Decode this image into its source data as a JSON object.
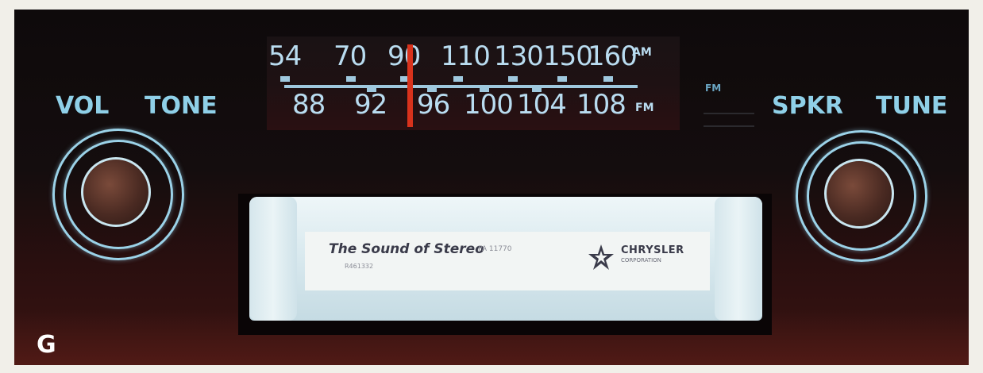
{
  "am_scale": [
    "54",
    "70",
    "90",
    "110",
    "130",
    "150",
    "160"
  ],
  "fm_scale": [
    "88",
    "92",
    "96",
    "100",
    "104",
    "108"
  ],
  "band_am": "AM",
  "band_fm": "FM",
  "fm_indicator": "FM",
  "controls": {
    "vol": "VOL",
    "tone": "TONE",
    "spkr": "SPKR",
    "tune": "TUNE"
  },
  "cartridge": {
    "title": "The Sound of Stereo",
    "code": "PA 11770",
    "code2": "R461332",
    "brand": "CHRYSLER",
    "brand_sub": "CORPORATION"
  },
  "corner_letter": "G",
  "colors": {
    "dial_text": "#b9dcf0",
    "needle": "#d8321c",
    "control_label": "#8fd0e8"
  }
}
